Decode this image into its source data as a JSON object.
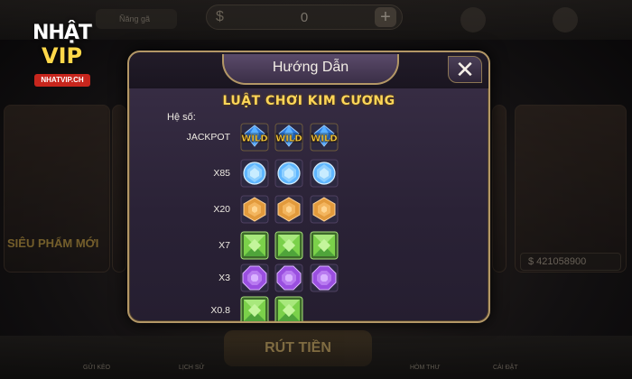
{
  "background": {
    "balance_currency": "$",
    "balance_value": "0",
    "plus_label": "+",
    "user_hint": "Ñăng gã",
    "logo_line1": "NHẬT",
    "logo_line2": "VIP",
    "logo_url": "NHATVIP.CH",
    "side_text": "SIÊU PHẨM MỚI",
    "jackpot_value": "$ 421058900",
    "bottom_button": "RÚT TIỀN",
    "nav_labels": [
      "GỬI KÈO",
      "LỊCH SỬ",
      "HÒM THƯ",
      "CẢI ĐẶT"
    ]
  },
  "dialog": {
    "title": "Hướng Dẫn",
    "close_symbol": "✕",
    "heading": "LUẬT CHƠI KIM CƯƠNG",
    "coef_label": "Hệ số:",
    "rows": [
      {
        "label": "JACKPOT",
        "symbol": "wild",
        "count": 3,
        "tile_text": "WILD"
      },
      {
        "label": "X85",
        "symbol": "blue-diamond",
        "count": 3
      },
      {
        "label": "X20",
        "symbol": "orange-gem",
        "count": 3
      },
      {
        "label": "X7",
        "symbol": "green-gem",
        "count": 3
      },
      {
        "label": "X3",
        "symbol": "purple-gem",
        "count": 3
      },
      {
        "label": "X0.8",
        "symbol": "green-gem",
        "count": 2
      }
    ]
  },
  "colors": {
    "gold": "#ffd658",
    "dialog_border": "#b39766",
    "dialog_bg": "#2a2236",
    "blue": "#5fb6ff",
    "orange": "#e29a3c",
    "green": "#7bd14a",
    "purple": "#9a4fe0"
  }
}
